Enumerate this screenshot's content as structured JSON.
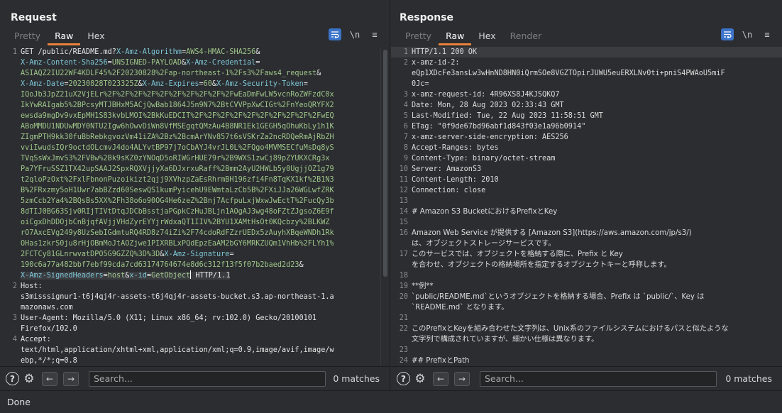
{
  "request": {
    "title": "Request",
    "tabs": [
      "Pretty",
      "Raw",
      "Hex"
    ],
    "active_tab": "Raw",
    "tools": [
      "wrap-icon",
      "\\n",
      "≡"
    ],
    "lines": [
      {
        "n": "1",
        "segs": [
          {
            "t": "GET /public/README.md?",
            "c": "k"
          },
          {
            "t": "X-Amz-Algorithm",
            "c": "p"
          },
          {
            "t": "=",
            "c": "k"
          },
          {
            "t": "AWS4-HMAC-SHA256",
            "c": "v"
          },
          {
            "t": "&\n",
            "c": "k"
          },
          {
            "t": "X-Amz-Content-Sha256",
            "c": "p"
          },
          {
            "t": "=",
            "c": "k"
          },
          {
            "t": "UNSIGNED-PAYLOAD",
            "c": "v"
          },
          {
            "t": "&",
            "c": "k"
          },
          {
            "t": "X-Amz-Credential",
            "c": "p"
          },
          {
            "t": "=\n",
            "c": "k"
          },
          {
            "t": "ASIAQZ2IU22WF4KDLF45%2F20230828%2Fap-northeast-1%2Fs3%2Faws4_request",
            "c": "v"
          },
          {
            "t": "&\n",
            "c": "k"
          },
          {
            "t": "X-Amz-Date",
            "c": "p"
          },
          {
            "t": "=",
            "c": "k"
          },
          {
            "t": "20230828T023325Z",
            "c": "v"
          },
          {
            "t": "&",
            "c": "k"
          },
          {
            "t": "X-Amz-Expires",
            "c": "p"
          },
          {
            "t": "=",
            "c": "k"
          },
          {
            "t": "60",
            "c": "v"
          },
          {
            "t": "&",
            "c": "k"
          },
          {
            "t": "X-Amz-Security-Token",
            "c": "p"
          },
          {
            "t": "=\n",
            "c": "k"
          },
          {
            "t": "IQoJb3JpZ21uX2VjELr%2F%2F%2F%2F%2F%2F%2F%2F%2F%2FwEaDmFwLW5vcnRoZWFzdC0x\nIkYwRAIgab5%2BPcsyMTJBHxM5ACjQwBab1864J5n9N7%2BtCVVPpXwCIGt%2FnYeoQRYFX2\newsda9mgDv9vxEpMH1S83kvbLMOI%2BkKuEDCIT%2F%2F%2F%2F%2F%2F%2F%2F%2F%2FwEQ\nABoMMDU1NDUwMDY0NTU2Igw6hOwvDiWn8VfMSEgqtQMzAu4B8NR1Ek1GEGH5qOhuKbLy1h1K\nZIgmPTH9kk30fuBbRebkgvozVm41iZA%2Bz%2BcmArYNv857t6sVSKrZa2ncRDQeRmAjRbZH\nvviIwudsIQr9octdOLcmvJ4do4ALYvtBP97j7oCbAYJ4vrJL0L%2FQgo4MVMSECfuMsDq8yS\nTVqSsWxJmvS3%2FVBw%2Bk9sKZ0zYNOqD5oRIWGrHUE79r%2B9WXS1zwCj89pZYUKXCRg3x\nPa7YFruSSZ1TX42upSAAJ2SpxRQXVjjyXa6DJxrxuRaff%2Bmm2AyU2HWLb5y0UgjjOZ1g79\nt2qloPzOxt%2FxlFbnonPuzoikizt2qjj9XVhzpZaEsRhrmBH196zfi4Fn8TqKX1kf%2B1N3\nB%2FRxzmy5oH1Uwr7abBZzd60SeswQS1kumPyicehU9EWmtaLzCb5B%2FXiJJa26WGLwfZRK\n5zmCcb2Ya4%2BQsBs5XX%2Fh38o6o90OG4He6zeZ%2Bnj7AcfpuLxjWxwJwEctT%2FucQy3b\n8dTIJ0BG63Sjv0RIjTIVtDtqJDCbBsstjaPGpkCzHuJBLjn1AOgAJ3wg48oFZtZJgsoZ6E9f\noiCgxDhDDOjbCnBjqfAVjjVHdZyrEYYjrWdxaQT1IIV%2BYU1XAMtHsOt0KQcbzy%2BLKWZ\nrO7AxcEVg249y8UzSebIGdmtuRQ4RD8z74iZi%2F74cdoRdFZzrUEDx5zAuyhXBqeWNDh1Rk\nOHas1zkrS0ju8rHjOBmMoJtAOZjwe1PIXRBLxPQdEpzEaAM2bGY6MRKZUQm1VhHb%2FLYh1%\n2FCTCy81GLnrwvatDPO5G9GZZQ%3D%3D",
            "c": "v"
          },
          {
            "t": "&",
            "c": "k"
          },
          {
            "t": "X-Amz-Signature",
            "c": "p"
          },
          {
            "t": "=\n",
            "c": "k"
          },
          {
            "t": "190c6a77a482bbf7ebf99cda7cd63174764674e8d6c312f13f5f07b2baed2d23",
            "c": "v"
          },
          {
            "t": "&\n",
            "c": "k"
          },
          {
            "t": "X-Amz-SignedHeaders",
            "c": "p",
            "hl": true
          },
          {
            "t": "=",
            "c": "k",
            "hl": true
          },
          {
            "t": "host",
            "c": "v",
            "hl": true
          },
          {
            "t": "&",
            "c": "k",
            "hl": true
          },
          {
            "t": "x-id",
            "c": "p",
            "hl": true
          },
          {
            "t": "=",
            "c": "k",
            "hl": true
          },
          {
            "t": "GetObject",
            "c": "v",
            "hl": true
          },
          {
            "t": "CURSOR",
            "c": "cursor"
          },
          {
            "t": " HTTP/1.1",
            "c": "k",
            "hl": true
          }
        ]
      },
      {
        "n": "2",
        "segs": [
          {
            "t": "Host:\ns3misssignur1-t6j4qj4r-assets-t6j4qj4r-assets-bucket.s3.ap-northeast-1.a\nmazonaws.com",
            "c": "k"
          }
        ]
      },
      {
        "n": "3",
        "segs": [
          {
            "t": "User-Agent: Mozilla/5.0 (X11; Linux x86_64; rv:102.0) Gecko/20100101\nFirefox/102.0",
            "c": "k"
          }
        ]
      },
      {
        "n": "4",
        "segs": [
          {
            "t": "Accept:\ntext/html,application/xhtml+xml,application/xml;q=0.9,image/avif,image/w\nebp,*/*;q=0.8",
            "c": "k"
          }
        ]
      }
    ],
    "search_placeholder": "Search...",
    "matches": "0 matches"
  },
  "response": {
    "title": "Response",
    "tabs": [
      "Pretty",
      "Raw",
      "Hex",
      "Render"
    ],
    "active_tab": "Raw",
    "tools": [
      "wrap-icon",
      "\\n",
      "≡"
    ],
    "lines": [
      {
        "n": "1",
        "t": "HTTP/1.1 200 OK",
        "hl": true
      },
      {
        "n": "2",
        "t": "x-amz-id-2:\neQp1XDcFe3ansLw3wHnND8HN0iQrmSOe8VGZTOpirJUWU5euERXLNv0ti+pniS4PWAoU5miF\n0Jc="
      },
      {
        "n": "3",
        "t": "x-amz-request-id: 4R96XS8J4KJSQKQ7"
      },
      {
        "n": "4",
        "t": "Date: Mon, 28 Aug 2023 02:33:43 GMT"
      },
      {
        "n": "5",
        "t": "Last-Modified: Tue, 22 Aug 2023 11:58:51 GMT"
      },
      {
        "n": "6",
        "t": "ETag: \"0f9de67bd96abf1d843f03e1a96b0914\""
      },
      {
        "n": "7",
        "t": "x-amz-server-side-encryption: AES256"
      },
      {
        "n": "8",
        "t": "Accept-Ranges: bytes"
      },
      {
        "n": "9",
        "t": "Content-Type: binary/octet-stream"
      },
      {
        "n": "10",
        "t": "Server: AmazonS3"
      },
      {
        "n": "11",
        "t": "Content-Length: 2010"
      },
      {
        "n": "12",
        "t": "Connection: close"
      },
      {
        "n": "13",
        "t": ""
      },
      {
        "n": "14",
        "t": "# Amazon S3 BucketにおけるPrefixとKey"
      },
      {
        "n": "15",
        "t": ""
      },
      {
        "n": "16",
        "t": "Amazon Web Service が提供する [Amazon S3](https://aws.amazon.com/jp/s3/)\nは、オブジェクトストレージサービスです。"
      },
      {
        "n": "17",
        "t": "このサービスでは、オブジェクトを格納する際に、Prefix と Key\nを合わせ、オブジェクトの格納場所を指定するオブジェクトキーと呼称します。"
      },
      {
        "n": "18",
        "t": ""
      },
      {
        "n": "19",
        "t": "**例**"
      },
      {
        "n": "20",
        "t": "`public/README.md`というオブジェクトを格納する場合、Prefix は `public/`、Key は\n`README.md` となります。"
      },
      {
        "n": "21",
        "t": ""
      },
      {
        "n": "22",
        "t": "このPrefixとKeyを組み合わせた文字列は、Unix系のファイルシステムにおけるパスと似たような\n文字列で構成されていますが、細かい仕様は異なります。"
      },
      {
        "n": "23",
        "t": ""
      },
      {
        "n": "24",
        "t": "## PrefixとPath"
      }
    ],
    "search_placeholder": "Search...",
    "matches": "0 matches"
  },
  "status": {
    "text": "Done"
  },
  "colors": {
    "accent": "#e8823d",
    "toggle_on": "#3b73c9",
    "param_name": "#7ec6d7",
    "param_value": "#9fc58a"
  }
}
